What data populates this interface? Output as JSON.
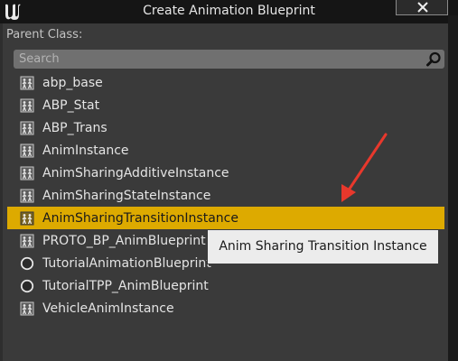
{
  "window": {
    "title": "Create Animation Blueprint"
  },
  "parent_class_label": "Parent Class:",
  "search": {
    "placeholder": "Search",
    "value": ""
  },
  "items": [
    {
      "label": "abp_base",
      "icon": "anim-blueprint-icon"
    },
    {
      "label": "ABP_Stat",
      "icon": "anim-blueprint-icon"
    },
    {
      "label": "ABP_Trans",
      "icon": "anim-blueprint-icon"
    },
    {
      "label": "AnimInstance",
      "icon": "anim-blueprint-icon"
    },
    {
      "label": "AnimSharingAdditiveInstance",
      "icon": "anim-blueprint-icon"
    },
    {
      "label": "AnimSharingStateInstance",
      "icon": "anim-blueprint-icon"
    },
    {
      "label": "AnimSharingTransitionInstance",
      "icon": "anim-blueprint-icon",
      "selected": true
    },
    {
      "label": "PROTO_BP_AnimBlueprint",
      "icon": "anim-blueprint-icon"
    },
    {
      "label": "TutorialAnimationBlueprint",
      "icon": "circle-class-icon"
    },
    {
      "label": "TutorialTPP_AnimBlueprint",
      "icon": "circle-class-icon"
    },
    {
      "label": "VehicleAnimInstance",
      "icon": "anim-blueprint-icon"
    }
  ],
  "tooltip": {
    "text": "Anim Sharing Transition Instance"
  },
  "colors": {
    "selection": "#ddaa00",
    "annotation_arrow": "#e8382c"
  }
}
